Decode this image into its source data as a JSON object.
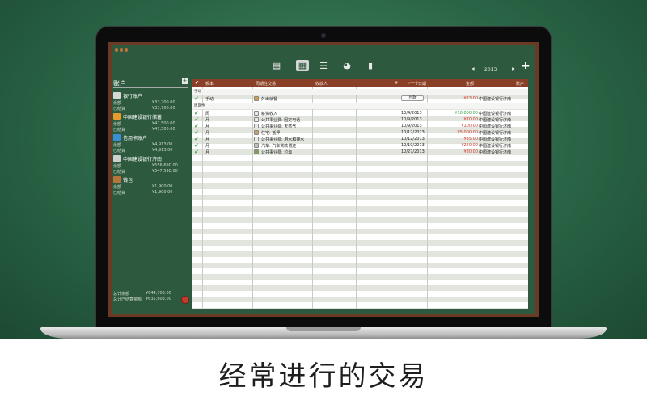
{
  "caption": "经常进行的交易",
  "toolbar": {
    "buttons": [
      {
        "name": "list-view-icon",
        "glyph": "▤",
        "active": false
      },
      {
        "name": "recurring-view-icon",
        "glyph": "▦",
        "active": true
      },
      {
        "name": "summary-view-icon",
        "glyph": "☰",
        "active": false
      },
      {
        "name": "pie-chart-icon",
        "glyph": "◕",
        "active": false
      },
      {
        "name": "bar-chart-icon",
        "glyph": "▮",
        "active": false
      }
    ],
    "prev": "◀",
    "year": "2013",
    "next": "▶",
    "add": "+"
  },
  "sidebar": {
    "title": "账户",
    "add": "+",
    "accounts": [
      {
        "name": "银行账户",
        "icon_color": "#d8d8d8",
        "balance_label": "余额",
        "balance": "¥33,700.00",
        "cleared_label": "已结算",
        "cleared": "¥33,700.00"
      },
      {
        "name": "中国建设银行储蓄",
        "icon_color": "#e89a2c",
        "balance_label": "余额",
        "balance": "¥47,500.00",
        "cleared_label": "已结算",
        "cleared": "¥47,500.00"
      },
      {
        "name": "信用卡账户",
        "icon_color": "#3a8fd4",
        "balance_label": "余额",
        "balance": "¥4,913.00",
        "cleared_label": "已结算",
        "cleared": "¥4,913.00"
      },
      {
        "name": "中国建设银行济南",
        "icon_color": "#cfcfcf",
        "balance_label": "余额",
        "balance": "¥556,690.00",
        "cleared_label": "已结算",
        "cleared": "¥547,590.00"
      },
      {
        "name": "钱包",
        "icon_color": "#b8743a",
        "balance_label": "余额",
        "balance": "¥1,900.00",
        "cleared_label": "已结算",
        "cleared": "¥1,900.00"
      }
    ],
    "total_label": "总计余额",
    "total": "¥644,703.00",
    "cleared_total_label": "总计已结算金额",
    "cleared_total": "¥635,603.00"
  },
  "table": {
    "headers": {
      "check": "✔",
      "freq": "频率",
      "desc": "周期性交易",
      "payee": "收款人",
      "num": "#",
      "next": "下一个日期",
      "amount": "金额",
      "account": "账户"
    },
    "section_manual": "手动",
    "section_recurring": "周期性",
    "pay_label": "付款",
    "manual_rows": [
      {
        "freq": "手动",
        "desc": "外出就餐",
        "icon_color": "#d89a3a",
        "next": "",
        "amount": "¥23.00",
        "type": "neg",
        "account": "中国建设银行济南"
      }
    ],
    "rows": [
      {
        "freq": "周",
        "desc": "薪资收入",
        "icon_color": "#e8e8e8",
        "next": "10/4/2013",
        "amount": "¥10,000.00",
        "type": "pos",
        "account": "中国建设银行济南"
      },
      {
        "freq": "月",
        "desc": "公共事业费: 固定电话",
        "icon_color": "#e8e8e8",
        "next": "10/9/2013",
        "amount": "¥70.00",
        "type": "neg",
        "account": "中国建设银行济南"
      },
      {
        "freq": "月",
        "desc": "公共事业费: 天然气",
        "icon_color": "#e8e8e8",
        "next": "10/9/2013",
        "amount": "¥100.00",
        "type": "neg",
        "account": "中国建设银行济南"
      },
      {
        "freq": "月",
        "desc": "住宅: 抵押",
        "icon_color": "#c8a070",
        "next": "10/12/2013",
        "amount": "¥5,000.00",
        "type": "neg",
        "account": "中国建设银行济南"
      },
      {
        "freq": "月",
        "desc": "公共事业费: 用水和排水",
        "icon_color": "#e8e8e8",
        "next": "10/12/2013",
        "amount": "¥35.00",
        "type": "neg",
        "account": "中国建设银行济南"
      },
      {
        "freq": "月",
        "desc": "汽车: 汽车贷款偿还",
        "icon_color": "#c0c0c0",
        "next": "10/19/2013",
        "amount": "¥250.00",
        "type": "neg",
        "account": "中国建设银行济南"
      },
      {
        "freq": "月",
        "desc": "公共事业费: 垃圾",
        "icon_color": "#7aa050",
        "next": "10/27/2013",
        "amount": "¥30.00",
        "type": "neg",
        "account": "中国建设银行济南"
      }
    ]
  }
}
